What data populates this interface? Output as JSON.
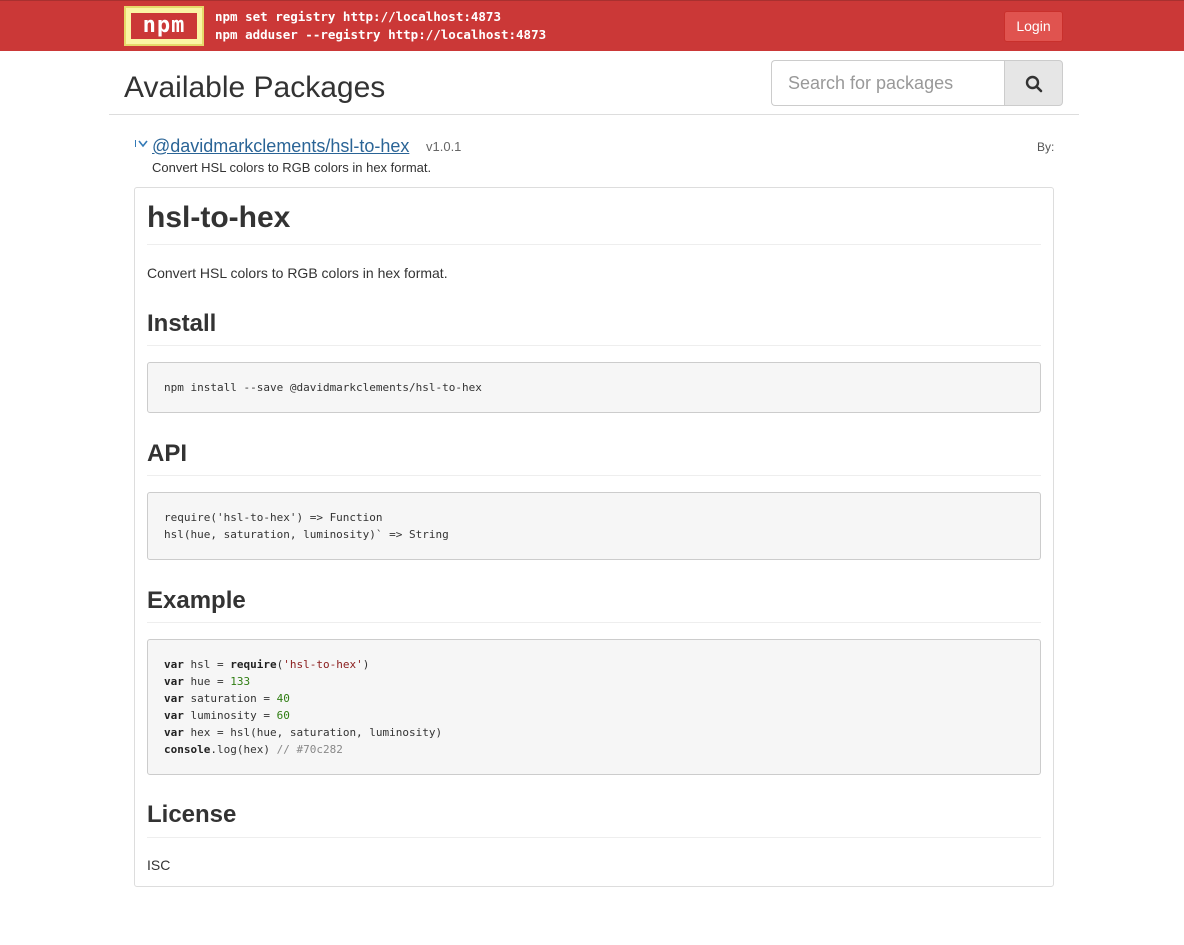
{
  "header": {
    "logo_text": "npm",
    "registry_lines": [
      "npm set registry http://localhost:4873",
      "npm adduser --registry http://localhost:4873"
    ],
    "login_label": "Login",
    "brand_color": "#cb3837"
  },
  "page": {
    "title": "Available Packages"
  },
  "search": {
    "placeholder": "Search for packages",
    "value": "",
    "icon": "search-icon"
  },
  "package": {
    "toggle_icon": "chevron-down-icon",
    "name": "@davidmarkclements/hsl-to-hex",
    "version": "v1.0.1",
    "by_label": "By:",
    "description": "Convert HSL colors to RGB colors in hex format."
  },
  "readme": {
    "title": "hsl-to-hex",
    "description": "Convert HSL colors to RGB colors in hex format.",
    "install_heading": "Install",
    "install_code": "npm install --save @davidmarkclements/hsl-to-hex",
    "api_heading": "API",
    "api_code": [
      "require('hsl-to-hex') => Function",
      "hsl(hue, saturation, luminosity)` => String"
    ],
    "example_heading": "Example",
    "example_code": {
      "line1": {
        "kw": "var",
        "rest": " hsl = ",
        "fn": "require",
        "open": "(",
        "str": "'hsl-to-hex'",
        "close": ")"
      },
      "line2": {
        "kw": "var",
        "rest": " hue = ",
        "num": "133"
      },
      "line3": {
        "kw": "var",
        "rest": " saturation = ",
        "num": "40"
      },
      "line4": {
        "kw": "var",
        "rest": " luminosity = ",
        "num": "60"
      },
      "line5": {
        "kw": "var",
        "rest": " hex = hsl(hue, saturation, luminosity)"
      },
      "line6": {
        "kw": "console",
        "rest": ".log(hex) ",
        "cmt": "// #70c282"
      }
    },
    "license_heading": "License",
    "license_text": "ISC"
  }
}
